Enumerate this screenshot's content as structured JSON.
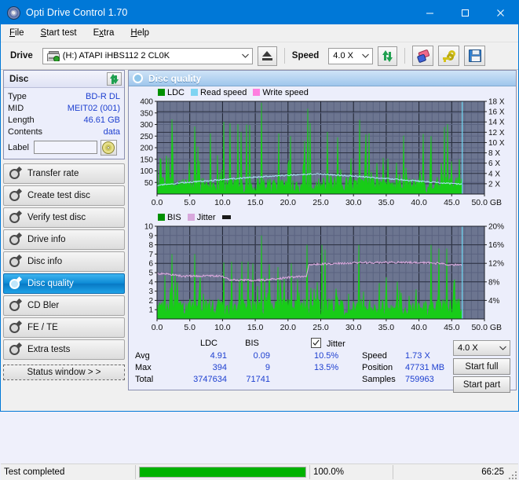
{
  "window": {
    "title": "Opti Drive Control 1.70",
    "icon": "disc-icon",
    "minimize": "minimize-icon",
    "maximize": "maximize-icon",
    "close": "close-icon"
  },
  "menu": {
    "items": [
      {
        "label": "File",
        "accel": "F"
      },
      {
        "label": "Start test",
        "accel": "S"
      },
      {
        "label": "Extra",
        "accel": "x"
      },
      {
        "label": "Help",
        "accel": "H"
      }
    ]
  },
  "toolbar": {
    "drive_label": "Drive",
    "drive_value": "(H:)  ATAPI iHBS112  2 CL0K",
    "drive_icon": "drive-icon",
    "eject_icon": "eject-icon",
    "speed_label": "Speed",
    "speed_value": "4.0 X",
    "refresh_icon": "refresh-icon",
    "eraser_icon": "eraser-icon",
    "key_icon": "key-icon",
    "save_icon": "save-icon"
  },
  "disc_panel": {
    "title": "Disc",
    "refresh_icon": "refresh-icon",
    "rows": [
      {
        "key": "Type",
        "value": "BD-R DL"
      },
      {
        "key": "MID",
        "value": "MEIT02 (001)"
      },
      {
        "key": "Length",
        "value": "46.61 GB"
      },
      {
        "key": "Contents",
        "value": "data"
      }
    ],
    "label_key": "Label",
    "label_value": "",
    "label_placeholder": "",
    "label_button_icon": "cd-icon"
  },
  "sidebar": {
    "items": [
      {
        "label": "Transfer rate",
        "icon": "disc-gear-icon",
        "active": false
      },
      {
        "label": "Create test disc",
        "icon": "disc-gear-icon",
        "active": false
      },
      {
        "label": "Verify test disc",
        "icon": "disc-gear-icon",
        "active": false
      },
      {
        "label": "Drive info",
        "icon": "disc-gear-icon",
        "active": false
      },
      {
        "label": "Disc info",
        "icon": "disc-gear-icon",
        "active": false
      },
      {
        "label": "Disc quality",
        "icon": "disc-gear-icon",
        "active": true
      },
      {
        "label": "CD Bler",
        "icon": "disc-gear-icon",
        "active": false
      },
      {
        "label": "FE / TE",
        "icon": "disc-gear-icon",
        "active": false
      },
      {
        "label": "Extra tests",
        "icon": "disc-gear-icon",
        "active": false
      }
    ],
    "status_window_label": "Status window > >"
  },
  "main": {
    "title": "Disc quality",
    "title_icon": "disc-gear-icon"
  },
  "stats": {
    "col_ldc": "LDC",
    "col_bis": "BIS",
    "rows": [
      {
        "label": "Avg",
        "ldc": "4.91",
        "bis": "0.09",
        "jitter": "10.5%"
      },
      {
        "label": "Max",
        "ldc": "394",
        "bis": "9",
        "jitter": "13.5%"
      },
      {
        "label": "Total",
        "ldc": "3747634",
        "bis": "71741",
        "jitter": ""
      }
    ],
    "jitter_label": "Jitter",
    "jitter_checked": true,
    "speed_label": "Speed",
    "speed_value": "1.73 X",
    "position_label": "Position",
    "position_value": "47731 MB",
    "samples_label": "Samples",
    "samples_value": "759963",
    "speed_select": "4.0 X",
    "start_full": "Start full",
    "start_part": "Start part"
  },
  "statusbar": {
    "message": "Test completed",
    "progress_percent": "100.0%",
    "progress_value": 100,
    "elapsed": "66:25"
  },
  "colors": {
    "accent": "#0078d7",
    "ldc_green": "#18cc18",
    "read_speed": "#7fd4f2",
    "write_speed": "#ff7fe0",
    "jitter": "#d8a8dc",
    "plot_bg": "#6c7590",
    "value_blue": "#1d3fd0",
    "progress_green": "#00b200"
  },
  "chart_data": [
    {
      "type": "line",
      "name": "disc-quality-ldc",
      "title": "Disc quality - LDC / Read speed",
      "xlabel": "GB",
      "ylabel": "LDC",
      "xlim": [
        0,
        50
      ],
      "ylim": [
        0,
        400
      ],
      "xticks": [
        "0.0",
        "5.0",
        "10.0",
        "15.0",
        "20.0",
        "25.0",
        "30.0",
        "35.0",
        "40.0",
        "45.0",
        "50.0 GB"
      ],
      "yticks": [
        "50",
        "100",
        "150",
        "200",
        "250",
        "300",
        "350",
        "400"
      ],
      "y2ticks": [
        "2 X",
        "4 X",
        "6 X",
        "8 X",
        "10 X",
        "12 X",
        "14 X",
        "16 X",
        "18 X"
      ],
      "y2lim": [
        0,
        18
      ],
      "grid": true,
      "legend": [
        {
          "label": "LDC",
          "color": "#009000"
        },
        {
          "label": "Read speed",
          "color": "#7fd4f2"
        },
        {
          "label": "Write speed",
          "color": "#ff7fe0"
        }
      ],
      "data_end_gb": 46.61,
      "series": [
        {
          "name": "Read speed",
          "color": "#a9dcf2",
          "x": [
            0,
            2,
            4,
            6,
            8,
            10,
            12,
            14,
            16,
            18,
            20,
            22,
            24,
            24.2,
            26,
            28,
            30,
            32,
            34,
            36,
            38,
            40,
            42,
            44,
            46,
            46.6
          ],
          "y": [
            1.7,
            2.0,
            2.2,
            2.4,
            2.6,
            2.8,
            3.0,
            3.2,
            3.35,
            3.5,
            3.65,
            3.8,
            3.9,
            3.95,
            3.8,
            3.65,
            3.5,
            3.3,
            3.1,
            2.9,
            2.7,
            2.5,
            2.3,
            2.1,
            1.95,
            1.9
          ]
        },
        {
          "name": "LDC",
          "color": "#18cc18",
          "note": "dense per-sample error spikes, baseline band 0-80, peaks up to 394",
          "peaks": [
            {
              "x": 2.3,
              "y": 322
            },
            {
              "x": 2.35,
              "y": 205
            },
            {
              "x": 5.7,
              "y": 292
            },
            {
              "x": 6.2,
              "y": 205
            },
            {
              "x": 8.1,
              "y": 315
            },
            {
              "x": 8.2,
              "y": 262
            },
            {
              "x": 10.2,
              "y": 312
            },
            {
              "x": 11.1,
              "y": 305
            },
            {
              "x": 12.3,
              "y": 302
            },
            {
              "x": 12.8,
              "y": 268
            },
            {
              "x": 13.7,
              "y": 300
            },
            {
              "x": 14.2,
              "y": 298
            },
            {
              "x": 15.9,
              "y": 394
            },
            {
              "x": 18.6,
              "y": 262
            },
            {
              "x": 20.4,
              "y": 250
            },
            {
              "x": 22.5,
              "y": 230
            },
            {
              "x": 23.0,
              "y": 368
            },
            {
              "x": 23.4,
              "y": 306
            },
            {
              "x": 26.0,
              "y": 268
            },
            {
              "x": 27.6,
              "y": 245
            },
            {
              "x": 30.9,
              "y": 320
            },
            {
              "x": 31.9,
              "y": 258
            },
            {
              "x": 32.4,
              "y": 262
            },
            {
              "x": 37.6,
              "y": 252
            },
            {
              "x": 40.6,
              "y": 260
            },
            {
              "x": 41.8,
              "y": 250
            },
            {
              "x": 43.9,
              "y": 290
            },
            {
              "x": 44.4,
              "y": 302
            }
          ]
        }
      ]
    },
    {
      "type": "line",
      "name": "disc-quality-bis",
      "title": "Disc quality - BIS / Jitter",
      "xlabel": "GB",
      "ylabel": "BIS",
      "xlim": [
        0,
        50
      ],
      "ylim": [
        0,
        10
      ],
      "xticks": [
        "0.0",
        "5.0",
        "10.0",
        "15.0",
        "20.0",
        "25.0",
        "30.0",
        "35.0",
        "40.0",
        "45.0",
        "50.0 GB"
      ],
      "yticks": [
        "1",
        "2",
        "3",
        "4",
        "5",
        "6",
        "7",
        "8",
        "9",
        "10"
      ],
      "y2ticks": [
        "4%",
        "8%",
        "12%",
        "16%",
        "20%"
      ],
      "y2lim": [
        0,
        20
      ],
      "grid": true,
      "legend": [
        {
          "label": "BIS",
          "color": "#009000"
        },
        {
          "label": "Jitter",
          "color": "#d8a8dc"
        }
      ],
      "data_end_gb": 46.61,
      "series": [
        {
          "name": "Jitter",
          "color": "#d8a8dc",
          "unit": "%",
          "x": [
            0,
            2,
            4,
            6,
            8,
            10,
            11,
            13,
            15,
            17,
            19,
            21,
            22.8,
            23.2,
            26,
            30,
            34,
            38,
            42,
            45,
            46.6
          ],
          "y": [
            9.8,
            9.6,
            9.2,
            9.3,
            9.3,
            9.2,
            8.5,
            8.4,
            8.3,
            8.5,
            8.8,
            9.1,
            9.2,
            11.8,
            11.9,
            12.1,
            12.2,
            12.2,
            12.1,
            11.7,
            11.6
          ]
        },
        {
          "name": "BIS",
          "color": "#18cc18",
          "note": "baseline band 0-2, frequent spikes to 3, max 9",
          "peaks": [
            {
              "x": 2.3,
              "y": 7.0
            },
            {
              "x": 5.7,
              "y": 7.0
            },
            {
              "x": 10.2,
              "y": 6.1
            },
            {
              "x": 11.4,
              "y": 6.2
            },
            {
              "x": 12.9,
              "y": 6.2
            },
            {
              "x": 13.9,
              "y": 6.2
            },
            {
              "x": 14.6,
              "y": 6.0
            },
            {
              "x": 15.9,
              "y": 9.0
            },
            {
              "x": 17.2,
              "y": 5.9
            },
            {
              "x": 18.5,
              "y": 5.6
            },
            {
              "x": 20.5,
              "y": 6.0
            },
            {
              "x": 22.9,
              "y": 8.0
            },
            {
              "x": 25.2,
              "y": 8.0
            },
            {
              "x": 25.6,
              "y": 7.5
            },
            {
              "x": 30.8,
              "y": 8.0
            },
            {
              "x": 41.8,
              "y": 8.0
            },
            {
              "x": 43.0,
              "y": 7.6
            },
            {
              "x": 44.3,
              "y": 7.6
            }
          ]
        }
      ]
    }
  ]
}
